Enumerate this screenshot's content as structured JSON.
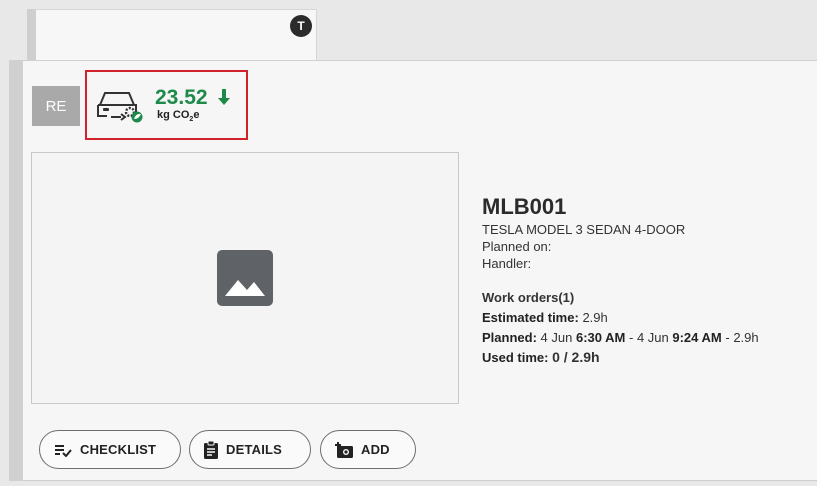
{
  "tab": {
    "avatar_initial": "T"
  },
  "badge": {
    "label": "RE"
  },
  "co2": {
    "value": "23.52",
    "unit_prefix": "kg CO",
    "unit_sub": "2",
    "unit_suffix": "e",
    "trend": "down",
    "accent": "#1e8a4a",
    "highlight_border": "#d0212d",
    "icon": "car-service-eco-icon"
  },
  "vehicle": {
    "plate": "MLB001",
    "model": "TESLA MODEL 3 SEDAN 4-DOOR",
    "planned_on_label": "Planned on:",
    "handler_label": "Handler:"
  },
  "work": {
    "orders_label": "Work orders(1)",
    "estimated_label": "Estimated time:",
    "estimated_value": "2.9h",
    "planned_label": "Planned:",
    "planned_start_date": "4 Jun",
    "planned_start_time": "6:30 AM",
    "planned_sep": "-",
    "planned_end_date": "4 Jun",
    "planned_end_time": "9:24 AM",
    "planned_duration": "- 2.9h",
    "used_label": "Used time:",
    "used_value": "0 / 2.9h"
  },
  "buttons": {
    "checklist": "CHECKLIST",
    "details": "DETAILS",
    "add": "ADD"
  }
}
